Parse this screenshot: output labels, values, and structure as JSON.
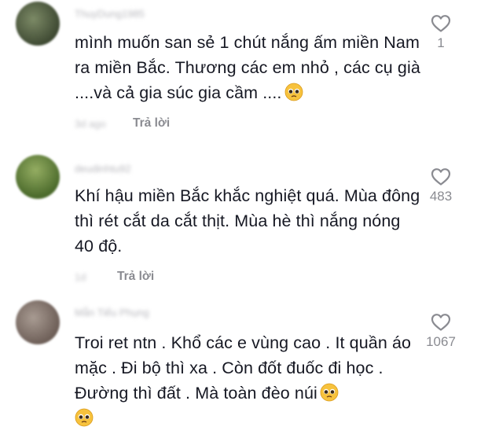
{
  "comments": [
    {
      "username": "ThuyDung1985",
      "text": "mình muốn san sẻ 1 chút nắng ấm miền Nam ra miền Bắc. Thương các em nhỏ , các cụ già ....và cả gia súc gia cầm ....",
      "emoji": "pleading-face-icon",
      "date": "3d ago",
      "reply_label": "Trả lời",
      "likes": "1",
      "avatar_color": "#5c6b4a"
    },
    {
      "username": "deudinhtu92",
      "text": "Khí hậu miền Bắc khắc nghiệt quá. Mùa đông thì rét cắt da cắt thịt. Mùa hè thì nắng nóng 40 độ.",
      "emoji": "",
      "date": "1d",
      "reply_label": "Trả lời",
      "likes": "483",
      "avatar_color": "#6f8a4a"
    },
    {
      "username": "Mẫn Tiểu Phụng",
      "text": "Troi ret ntn . Khổ các e vùng cao . It quần áo mặc . Đi bộ thì xa . Còn đốt đuốc đi học . Đường thì đất . Mà toàn đèo núi",
      "emoji": "pleading-face-icon",
      "date": "",
      "reply_label": "",
      "likes": "1067",
      "avatar_color": "#8a7a70"
    }
  ],
  "colors": {
    "text": "#161823",
    "muted": "#8a8b91",
    "heart_stroke": "#8a8b91",
    "emoji_face": "#f7c23d"
  }
}
